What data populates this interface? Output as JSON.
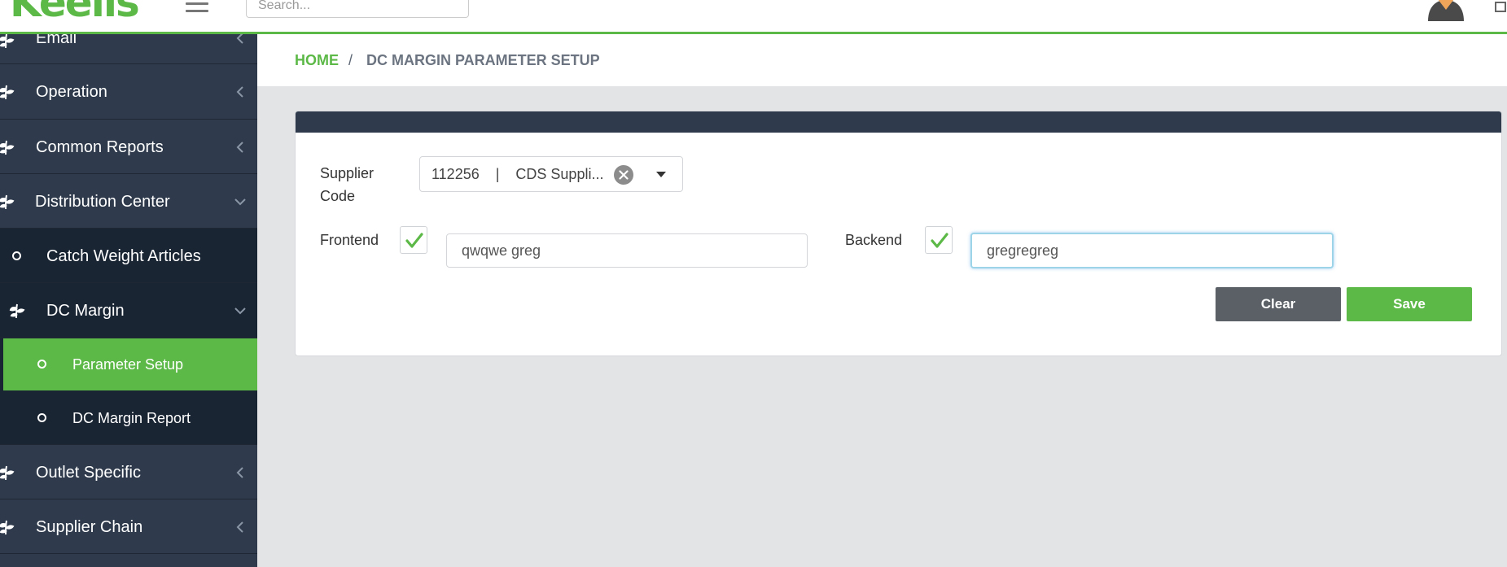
{
  "header": {
    "logo_text": "Keells",
    "search_placeholder": "Search..."
  },
  "sidebar": {
    "items": [
      {
        "label": "Email",
        "icon": "leaf-icon",
        "chevron": "left"
      },
      {
        "label": "Operation",
        "icon": "leaf-icon",
        "chevron": "left"
      },
      {
        "label": "Common Reports",
        "icon": "leaf-icon",
        "chevron": "left"
      },
      {
        "label": "Distribution Center",
        "icon": "leaf-icon",
        "chevron": "down"
      },
      {
        "label": "Catch Weight Articles",
        "icon": "circle-icon"
      },
      {
        "label": "DC Margin",
        "icon": "leaf-icon",
        "chevron": "down"
      },
      {
        "label": "Parameter Setup",
        "icon": "circle-icon",
        "active": true
      },
      {
        "label": "DC Margin Report",
        "icon": "circle-icon"
      },
      {
        "label": "Outlet Specific",
        "icon": "leaf-icon",
        "chevron": "left"
      },
      {
        "label": "Supplier Chain",
        "icon": "leaf-icon",
        "chevron": "left"
      }
    ]
  },
  "breadcrumb": {
    "home": "HOME",
    "separator": "/",
    "current": "DC MARGIN PARAMETER SETUP"
  },
  "form": {
    "supplier_label_line1": "Supplier",
    "supplier_label_line2": "Code",
    "supplier_value": "112256    |    CDS Suppli...",
    "frontend_label": "Frontend",
    "frontend_checked": true,
    "frontend_value": "qwqwe greg",
    "backend_label": "Backend",
    "backend_checked": true,
    "backend_value": "gregregreg",
    "clear_label": "Clear",
    "save_label": "Save"
  },
  "colors": {
    "brand_green": "#5cb947",
    "sidebar_bg": "#2f3b4c",
    "submenu_bg": "#1a2534",
    "clear_button": "#5a6066"
  }
}
